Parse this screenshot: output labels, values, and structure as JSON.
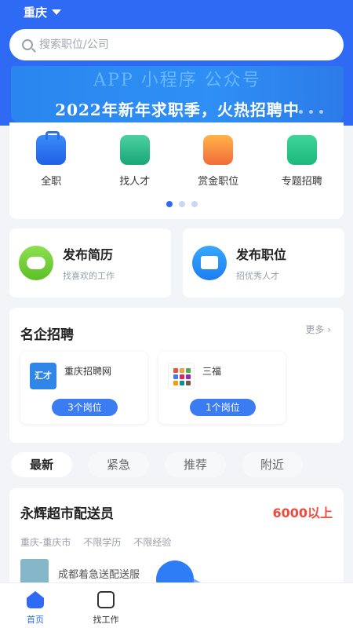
{
  "header": {
    "city": "重庆"
  },
  "search": {
    "placeholder": "搜索职位/公司"
  },
  "banner": {
    "line1": "APP 小程序 公众号",
    "line2": "2022年新年求职季，火热招聘中"
  },
  "categories": [
    {
      "label": "全职",
      "icon": "briefcase-icon"
    },
    {
      "label": "找人才",
      "icon": "graduation-cap-icon"
    },
    {
      "label": "赏金职位",
      "icon": "coin-stack-icon"
    },
    {
      "label": "专题招聘",
      "icon": "map-icon"
    }
  ],
  "carousel": {
    "pages": 3,
    "active": 1
  },
  "publish": [
    {
      "title": "发布简历",
      "subtitle": "找喜欢的工作",
      "icon": "resume-face-icon"
    },
    {
      "title": "发布职位",
      "subtitle": "招优秀人才",
      "icon": "folder-icon"
    }
  ],
  "famous": {
    "title": "名企招聘",
    "more": "更多 ›",
    "companies": [
      {
        "name": "重庆招聘网",
        "logo_text": "汇才",
        "count": "3个岗位"
      },
      {
        "name": "三福",
        "logo_text": "",
        "count": "1个岗位"
      }
    ]
  },
  "filters": [
    {
      "label": "最新",
      "active": true
    },
    {
      "label": "紧急",
      "active": false
    },
    {
      "label": "推荐",
      "active": false
    },
    {
      "label": "附近",
      "active": false
    }
  ],
  "job": {
    "title": "永辉超市配送员",
    "salary": "6000以上",
    "tags": [
      "重庆-重庆市",
      "不限学历",
      "不限经验"
    ],
    "company": "成都着急送配送服"
  },
  "nav": [
    {
      "label": "首页",
      "icon": "home-icon",
      "active": true
    },
    {
      "label": "找工作",
      "icon": "briefcase-icon",
      "active": false
    }
  ],
  "colors": {
    "primary": "#2f6af4",
    "salary": "#f24b3b"
  }
}
